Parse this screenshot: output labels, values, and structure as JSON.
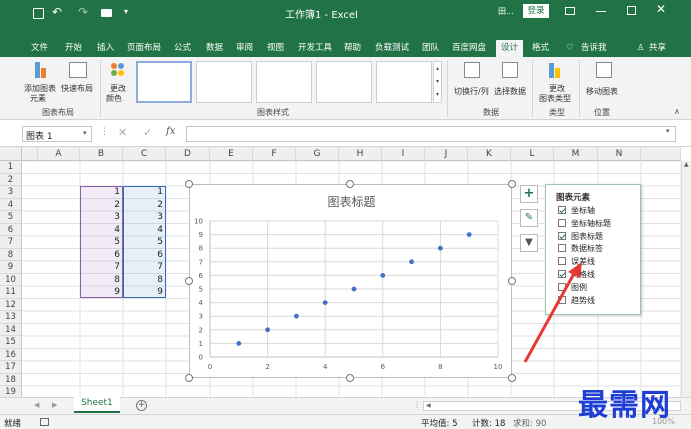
{
  "title_bar": {
    "title": "工作簿1 - Excel",
    "login_label": "登录",
    "ellipsis_label": "田..."
  },
  "tabs": [
    "文件",
    "开始",
    "插入",
    "页面布局",
    "公式",
    "数据",
    "审阅",
    "视图",
    "开发工具",
    "帮助",
    "负载测试",
    "团队",
    "百度网盘",
    "设计",
    "格式"
  ],
  "active_tab": "设计",
  "tell_me": "告诉我",
  "share": "共享",
  "ribbon": {
    "add_element": "添加图表",
    "add_element_2": "元素",
    "quick_layout": "快速布局",
    "change_color": "更改",
    "change_color_2": "颜色",
    "switch_rowcol": "切换行/列",
    "select_data": "选择数据",
    "change_type": "更改",
    "change_type_2": "图表类型",
    "move_chart": "移动图表",
    "groups": {
      "layout": "图表布局",
      "styles": "图表样式",
      "data": "数据",
      "type": "类型",
      "location": "位置"
    }
  },
  "formula_bar": {
    "name_box": "图表 1",
    "fx": "fx"
  },
  "columns": [
    "A",
    "B",
    "C",
    "D",
    "E",
    "F",
    "G",
    "H",
    "I",
    "J",
    "K",
    "L",
    "M",
    "N"
  ],
  "rows": [
    "1",
    "2",
    "3",
    "4",
    "5",
    "6",
    "7",
    "8",
    "9",
    "10",
    "11",
    "12",
    "13",
    "14",
    "15",
    "16",
    "17",
    "18",
    "19"
  ],
  "col_b_values": [
    "1",
    "2",
    "3",
    "4",
    "5",
    "6",
    "7",
    "8",
    "9"
  ],
  "col_c_values": [
    "1",
    "2",
    "3",
    "4",
    "5",
    "6",
    "7",
    "8",
    "9"
  ],
  "chart_data": {
    "type": "scatter",
    "title": "图表标题",
    "x": [
      1,
      2,
      3,
      4,
      5,
      6,
      7,
      8,
      9
    ],
    "y": [
      1,
      2,
      3,
      4,
      5,
      6,
      7,
      8,
      9
    ],
    "xlim": [
      0,
      10
    ],
    "ylim": [
      0,
      10
    ],
    "x_ticks": [
      "0",
      "2",
      "4",
      "6",
      "8",
      "10"
    ],
    "y_ticks": [
      "0",
      "1",
      "2",
      "3",
      "4",
      "5",
      "6",
      "7",
      "8",
      "9",
      "10"
    ],
    "grid": true,
    "marker_color": "#4472c4"
  },
  "chart_elements_panel": {
    "title": "图表元素",
    "items": [
      {
        "label": "坐标轴",
        "checked": true
      },
      {
        "label": "坐标轴标题",
        "checked": false
      },
      {
        "label": "图表标题",
        "checked": true
      },
      {
        "label": "数据标签",
        "checked": false
      },
      {
        "label": "误差线",
        "checked": false
      },
      {
        "label": "网格线",
        "checked": true
      },
      {
        "label": "图例",
        "checked": false
      },
      {
        "label": "趋势线",
        "checked": false
      }
    ]
  },
  "sheet_tabs": [
    "Sheet1"
  ],
  "status": {
    "ready": "就绪",
    "average": "平均值: 5",
    "count": "计数: 18",
    "sum": "求和: 90",
    "zoom": "100%"
  },
  "watermark": "最需网",
  "colors": {
    "excel_green": "#217346",
    "arrow_red": "#e53935",
    "watermark_blue": "#1e3fd6"
  }
}
